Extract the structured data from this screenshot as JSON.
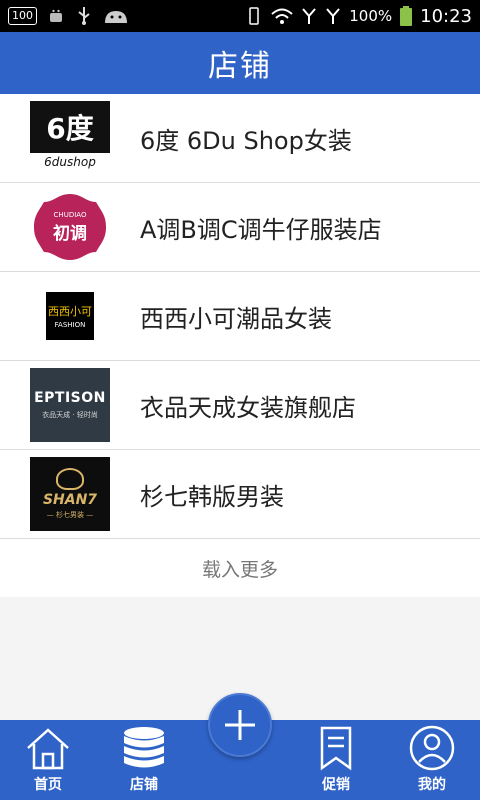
{
  "status_bar": {
    "left_badge": "100",
    "battery_percent": "100%",
    "time": "10:23"
  },
  "header": {
    "title": "店铺"
  },
  "shops": [
    {
      "name": "6度 6Du Shop女装",
      "logo_text": "6度",
      "logo_sub": "6dushop"
    },
    {
      "name": "A调B调C调牛仔服装店",
      "logo_text": "初调",
      "logo_sub": "CHUDIAO"
    },
    {
      "name": "西西小可潮品女装",
      "logo_text": "西西小可",
      "logo_sub": "FASHION"
    },
    {
      "name": "衣品天成女装旗舰店",
      "logo_text": "EPTISON",
      "logo_sub": "衣品天成 · 轻时尚"
    },
    {
      "name": "杉七韩版男装",
      "logo_text": "SHAN7",
      "logo_sub": "— 杉七男装 —"
    }
  ],
  "load_more": "载入更多",
  "bottom_nav": {
    "items": [
      {
        "label": "首页",
        "icon": "home-icon"
      },
      {
        "label": "店铺",
        "icon": "database-icon"
      },
      {
        "label": "促销",
        "icon": "bookmark-icon"
      },
      {
        "label": "我的",
        "icon": "user-icon"
      }
    ],
    "fab_icon": "plus-icon"
  },
  "colors": {
    "primary": "#2f63c8",
    "status_bar": "#000000"
  }
}
